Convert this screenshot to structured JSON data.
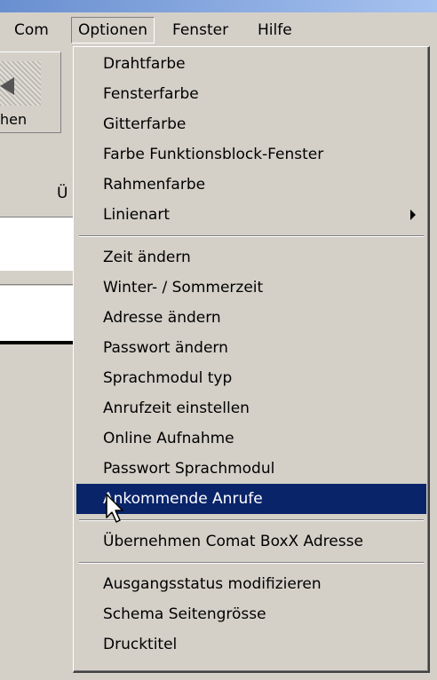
{
  "menubar": {
    "items": [
      "Com",
      "Optionen",
      "Fenster",
      "Hilfe"
    ],
    "active_index": 1
  },
  "background": {
    "toolbar_button_label": "hen",
    "column_header": "Ü"
  },
  "dropdown": {
    "groups": [
      {
        "items": [
          {
            "label": "Drahtfarbe"
          },
          {
            "label": "Fensterfarbe"
          },
          {
            "label": "Gitterfarbe"
          },
          {
            "label": "Farbe Funktionsblock-Fenster"
          },
          {
            "label": "Rahmenfarbe"
          },
          {
            "label": "Linienart",
            "submenu": true
          }
        ]
      },
      {
        "items": [
          {
            "label": "Zeit ändern"
          },
          {
            "label": "Winter- / Sommerzeit"
          },
          {
            "label": "Adresse ändern"
          },
          {
            "label": "Passwort ändern"
          },
          {
            "label": "Sprachmodul typ"
          },
          {
            "label": "Anrufzeit einstellen"
          },
          {
            "label": "Online Aufnahme"
          },
          {
            "label": "Passwort Sprachmodul"
          },
          {
            "label": "Ankommende Anrufe",
            "highlighted": true
          }
        ]
      },
      {
        "items": [
          {
            "label": "Übernehmen Comat BoxX Adresse"
          }
        ]
      },
      {
        "items": [
          {
            "label": "Ausgangsstatus modifizieren"
          },
          {
            "label": "Schema Seitengrösse"
          },
          {
            "label": "Drucktitel"
          }
        ]
      }
    ]
  },
  "colors": {
    "highlight": "#0a246a",
    "face": "#d4d0c8"
  }
}
